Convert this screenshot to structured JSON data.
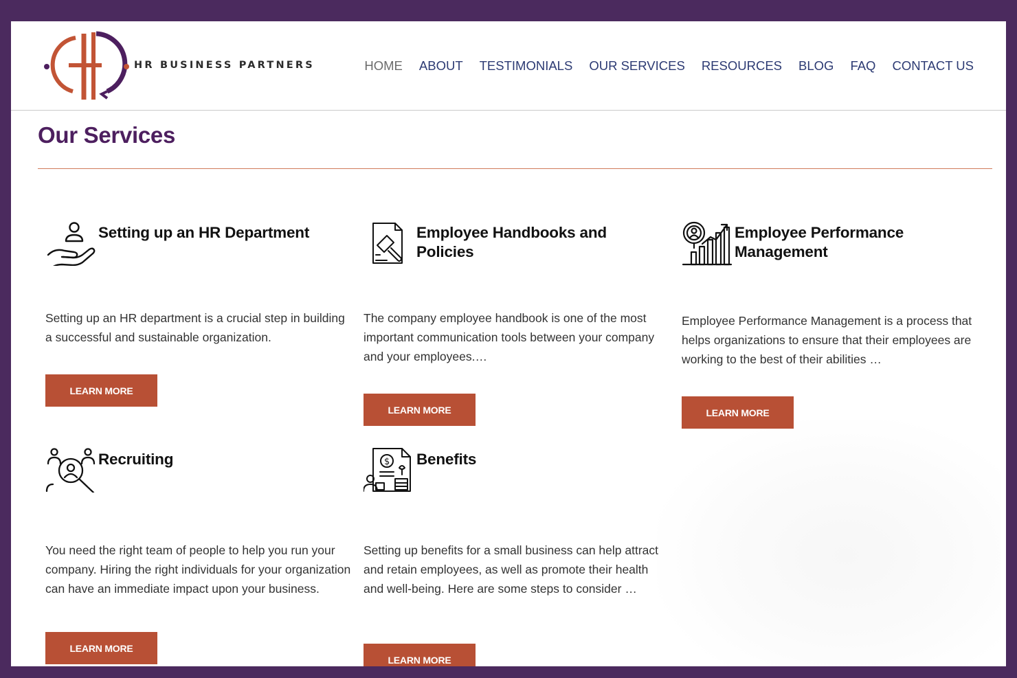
{
  "brand": {
    "logo_text": "HR BUSINESS PARTNERS",
    "colors": {
      "purple": "#4b2a5e",
      "orange": "#c25435",
      "navy": "#2c3a73",
      "button": "#b85035"
    }
  },
  "nav": {
    "items": [
      {
        "label": "HOME",
        "active": true
      },
      {
        "label": "ABOUT"
      },
      {
        "label": "TESTIMONIALS"
      },
      {
        "label": "OUR SERVICES"
      },
      {
        "label": "RESOURCES"
      },
      {
        "label": "BLOG"
      },
      {
        "label": "FAQ"
      },
      {
        "label": "CONTACT US"
      }
    ]
  },
  "page": {
    "title": "Our Services"
  },
  "services": [
    {
      "icon": "hand-person-icon",
      "title": "Setting up an HR Department",
      "description": "Setting up an HR department is a crucial step in building a successful and sustainable organization.",
      "button": "LEARN MORE"
    },
    {
      "icon": "handbook-gavel-icon",
      "title": "Employee Handbooks and Policies",
      "description": "The company employee handbook is one of the most important communication tools between your company and your employees.…",
      "button": "LEARN MORE"
    },
    {
      "icon": "performance-chart-icon",
      "title": "Employee Performance Management",
      "description": "Employee Performance Management is a process that helps organizations to ensure that their employees are working to the best of their abilities …",
      "button": "LEARN MORE"
    },
    {
      "icon": "recruiting-search-icon",
      "title": "Recruiting",
      "description": "You need the right team of people to help you run your company. Hiring the right individuals for your organization can have an immediate impact upon your business.",
      "button": "LEARN MORE"
    },
    {
      "icon": "benefits-document-icon",
      "title": "Benefits",
      "description": "Setting up benefits for a small business can help attract and retain employees, as well as promote their health and well-being. Here are some steps to consider …",
      "button": "LEARN MORE"
    }
  ]
}
